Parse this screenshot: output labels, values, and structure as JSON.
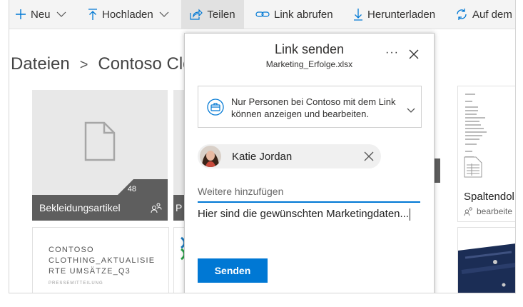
{
  "toolbar": {
    "new_label": "Neu",
    "upload_label": "Hochladen",
    "share_label": "Teilen",
    "copy_link_label": "Link abrufen",
    "download_label": "Herunterladen",
    "automate_label": "Auf dem"
  },
  "breadcrumb": {
    "root": "Dateien",
    "separator": ">",
    "current": "Contoso Cloth"
  },
  "tiles": {
    "t1_name": "Bekleidungsartikel",
    "t1_badge": "48",
    "t2_prefix": "P",
    "t3_name": "Spaltendol",
    "t3_sub": "bearbeite",
    "doc_line1": "CONTOSO",
    "doc_line2": "CLOTHING_AKTUALISIE",
    "doc_line3": "RTE UMSÄTZE_Q3",
    "doc_sub": "PRESSEMITTEILUNG"
  },
  "dialog": {
    "title": "Link senden",
    "filename": "Marketing_Erfolge.xlsx",
    "more": "···",
    "permission_line1": "Nur Personen bei Contoso mit dem Link",
    "permission_line2": "können anzeigen und bearbeiten.",
    "recipient_name": "Katie Jordan",
    "add_more_placeholder": "Weitere hinzufügen",
    "message": "Hier sind die gewünschten Marketingdaten...",
    "send_label": "Senden"
  },
  "colors": {
    "accent": "#0078d4",
    "tile_footer": "#5e5e5e"
  }
}
